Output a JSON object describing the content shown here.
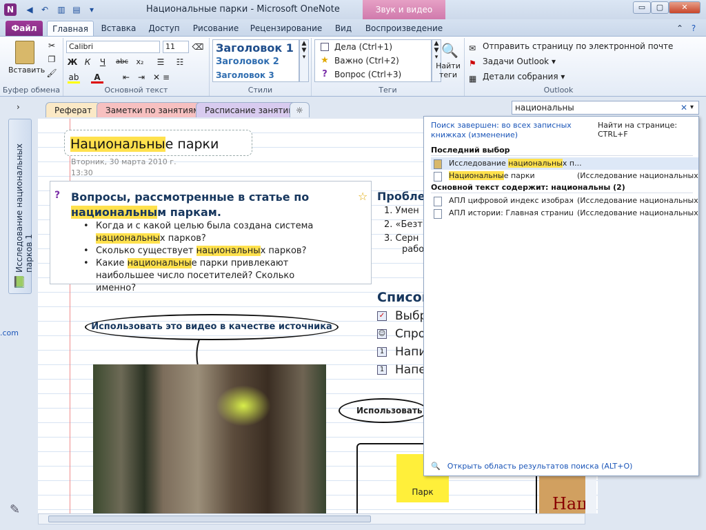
{
  "window": {
    "title": "Национальные парки  -  Microsoft OneNote",
    "context_tab": "Звук и видео",
    "minimize": "▭",
    "maximize": "▢",
    "close": "✕"
  },
  "ribbon_tabs": {
    "file": "Файл",
    "home": "Главная",
    "insert": "Вставка",
    "share": "Доступ",
    "draw": "Рисование",
    "review": "Рецензирование",
    "view": "Вид",
    "playback": "Воспроизведение"
  },
  "clipboard": {
    "paste": "Вставить",
    "label": "Буфер обмена"
  },
  "basic_text": {
    "font": "Calibri",
    "size": "11",
    "bold": "Ж",
    "italic": "К",
    "underline": "Ч",
    "strike": "abc",
    "subscript": "x₂",
    "label": "Основной текст"
  },
  "styles": {
    "h1": "Заголовок 1",
    "h2": "Заголовок 2",
    "h3": "Заголовок 3",
    "label": "Стили"
  },
  "tags": {
    "todo": "Дела (Ctrl+1)",
    "important": "Важно (Ctrl+2)",
    "question": "Вопрос (Ctrl+3)",
    "find": "Найти\nтеги",
    "label": "Теги"
  },
  "outlook": {
    "email": "Отправить страницу по электронной почте",
    "tasks": "Задачи Outlook ▾",
    "meeting": "Детали собрания ▾",
    "label": "Outlook"
  },
  "section_tabs": {
    "s1": "Реферат",
    "s2": "Заметки по занятиям",
    "s3": "Расписание занятий"
  },
  "search": {
    "query": "национальны",
    "clear": "✕"
  },
  "notebook": {
    "label": "Исследование национальных парков 1"
  },
  "page": {
    "title_hl": "Национальны",
    "title_rest": "е парки",
    "date": "Вторник, 30 марта 2010 г.",
    "time": "13:30",
    "q_head_1": "Вопросы, рассмотренные в статье по ",
    "q_head_hl": "национальны",
    "q_head_2": "м паркам.",
    "q1_a": "Когда и с какой целью была создана система ",
    "q1_hl": "национальны",
    "q1_b": "х парков?",
    "q2_a": "Сколько существует ",
    "q2_hl": "национальны",
    "q2_b": "х парков?",
    "q3_a": "Какие ",
    "q3_hl": "национальны",
    "q3_b": "е парки привлекают наибольшее число посетителей? Сколько именно?",
    "problem": "Проблем",
    "n1": "1.   Умен",
    "n2": "2.   «Безт",
    "n3": "3.   Серн",
    "n3b": "рабо",
    "list_head": "Список",
    "t1": "Выбрат",
    "t2": "Спросит",
    "t3": "Написат",
    "t4": "Напечат",
    "callout1": "Использовать  это видео  в качестве  источника",
    "callout2": "Использовать эт",
    "park": "Парк",
    "brown": "Нац"
  },
  "results": {
    "scope": "Поиск завершен: во всех записных книжках (изменение)",
    "find_hint": "Найти на странице: CTRL+F",
    "recent_head": "Последний выбор",
    "r1_a": "Исследование ",
    "r1_hl": "национальны",
    "r1_b": "х п...",
    "r2_hl": "Национальны",
    "r2_b": "е парки",
    "r2_ctx": "(Исследование национальных п...",
    "body_head": "Основной текст содержит: национальны (2)",
    "r3": "АПЛ цифровой индекс изображ...",
    "r3_ctx": "(Исследование национальных п...",
    "r4": "АПЛ истории: Главная страница",
    "r4_ctx": "(Исследование национальных п...",
    "open_pane": "Открыть область результатов поиска (ALT+O)"
  },
  "misc": {
    "left_strip": ".com"
  }
}
